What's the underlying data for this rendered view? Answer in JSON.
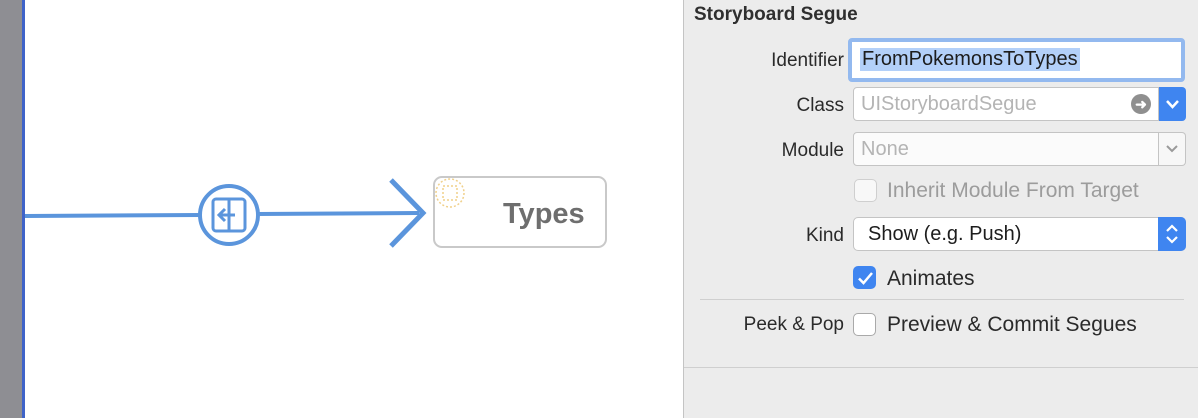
{
  "canvas": {
    "scene_label": "Types"
  },
  "inspector": {
    "section_title": "Storyboard Segue",
    "identifier": {
      "label": "Identifier",
      "value": "FromPokemonsToTypes"
    },
    "class": {
      "label": "Class",
      "placeholder": "UIStoryboardSegue"
    },
    "module": {
      "label": "Module",
      "placeholder": "None"
    },
    "inherit_module": {
      "label": "Inherit Module From Target",
      "checked": false,
      "enabled": false
    },
    "kind": {
      "label": "Kind",
      "value": "Show (e.g. Push)"
    },
    "animates": {
      "label": "Animates",
      "checked": true
    },
    "peek_pop": {
      "label": "Peek & Pop",
      "checkbox_label": "Preview & Commit Segues",
      "checked": false
    }
  },
  "colors": {
    "segue_line": "#5b95dc",
    "accent": "#3f85f0",
    "selection": "#b3d0f9",
    "focus_ring": "#93b9ef"
  },
  "icons": [
    "segue-show-icon",
    "arrowhead-icon",
    "scene-placeholder-icon",
    "navigate-arrow-icon",
    "chevron-down-icon",
    "stepper-icon",
    "checkmark-icon"
  ]
}
